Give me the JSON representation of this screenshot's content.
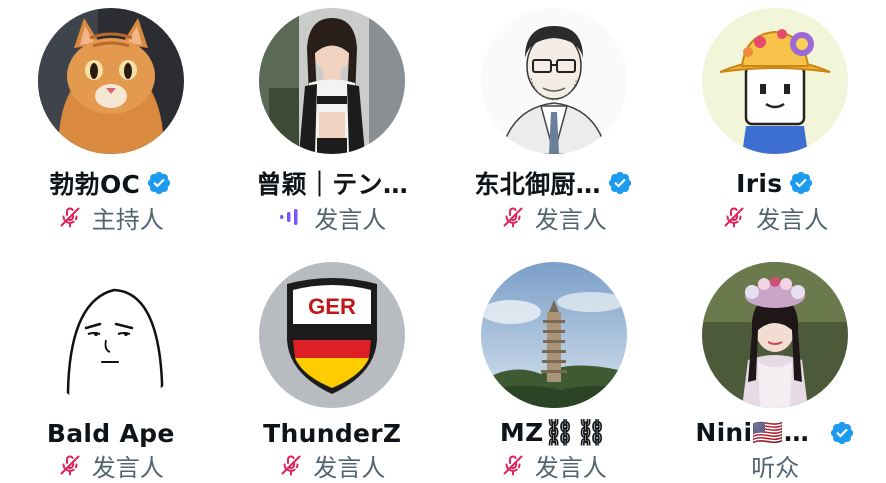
{
  "participants": [
    {
      "name": "勃勃OC",
      "role": "主持人",
      "verified": true,
      "status_icon": "mic-off-icon",
      "avatar": "cat-avatar"
    },
    {
      "name": "曾颖｜テン…",
      "role": "发言人",
      "verified": false,
      "status_icon": "speaking-icon",
      "avatar": "girl-photo-avatar"
    },
    {
      "name": "东北御厨…",
      "role": "发言人",
      "verified": true,
      "status_icon": "mic-off-icon",
      "avatar": "sketch-man-avatar"
    },
    {
      "name": "Iris",
      "role": "发言人",
      "verified": true,
      "status_icon": "mic-off-icon",
      "avatar": "cartoon-flower-hat-avatar"
    },
    {
      "name": "Bald Ape",
      "role": "发言人",
      "verified": false,
      "status_icon": "mic-off-icon",
      "avatar": "doodle-face-avatar"
    },
    {
      "name": "ThunderZ",
      "role": "发言人",
      "verified": false,
      "status_icon": "mic-off-icon",
      "avatar": "ger-shield-avatar"
    },
    {
      "name": "MZ⛓⛓",
      "role": "发言人",
      "verified": false,
      "status_icon": "mic-off-icon",
      "avatar": "pagoda-photo-avatar"
    },
    {
      "name": "Nini🇺🇸…",
      "role": "听众",
      "verified": true,
      "status_icon": "",
      "avatar": "costume-girl-avatar"
    }
  ],
  "colors": {
    "verified_blue": "#1d9bf0",
    "mic_off_pink": "#e0245e",
    "speaking_purple": "#7856ff",
    "role_gray": "#536471"
  }
}
